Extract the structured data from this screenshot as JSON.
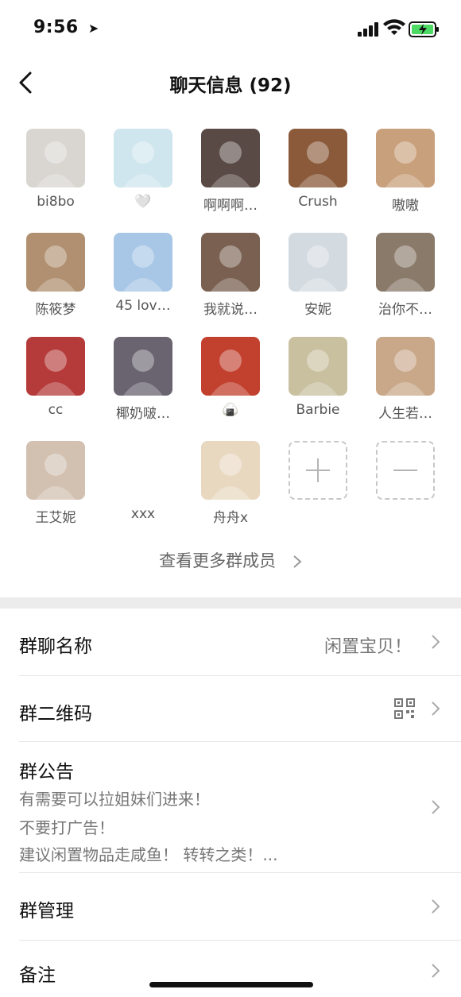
{
  "status": {
    "time": "9:56",
    "location_icon": "location-arrow-icon"
  },
  "nav": {
    "title": "聊天信息 (92)"
  },
  "members": [
    {
      "name": "bi8bo",
      "bg": "#d9d6d2"
    },
    {
      "name": "🤍",
      "bg": "#cfe6ef"
    },
    {
      "name": "啊啊啊…",
      "bg": "#5a4a46"
    },
    {
      "name": "Crush",
      "bg": "#8a5a3a"
    },
    {
      "name": "嗷嗷",
      "bg": "#c9a07c"
    },
    {
      "name": "陈筱梦",
      "bg": "#b09070"
    },
    {
      "name": "45 lov…",
      "bg": "#a8c7e6"
    },
    {
      "name": "我就说…",
      "bg": "#7a6050"
    },
    {
      "name": "安妮",
      "bg": "#d4dbe0"
    },
    {
      "name": "治你不…",
      "bg": "#8a7a6a"
    },
    {
      "name": "cc",
      "bg": "#b53a3a"
    },
    {
      "name": "椰奶啵…",
      "bg": "#6a6470"
    },
    {
      "name": "🍙",
      "bg": "#c2402e"
    },
    {
      "name": "Barbie",
      "bg": "#c9c0a0"
    },
    {
      "name": "人生若…",
      "bg": "#c9a88a"
    },
    {
      "name": "王艾妮",
      "bg": "#d2c0b0"
    },
    {
      "name": "xxx",
      "bg": "#ffffff"
    },
    {
      "name": "舟舟x",
      "bg": "#e8d8c0"
    }
  ],
  "more_members": "查看更多群成员",
  "rows": {
    "group_name": {
      "label": "群聊名称",
      "value": "闲置宝贝！"
    },
    "qr": {
      "label": "群二维码"
    },
    "notice": {
      "label": "群公告",
      "lines": [
        "有需要可以拉姐妹们进来！",
        "不要打广告！",
        "建议闲置物品走咸鱼！ 转转之类！..."
      ]
    },
    "manage": {
      "label": "群管理"
    },
    "remark": {
      "label": "备注"
    }
  }
}
